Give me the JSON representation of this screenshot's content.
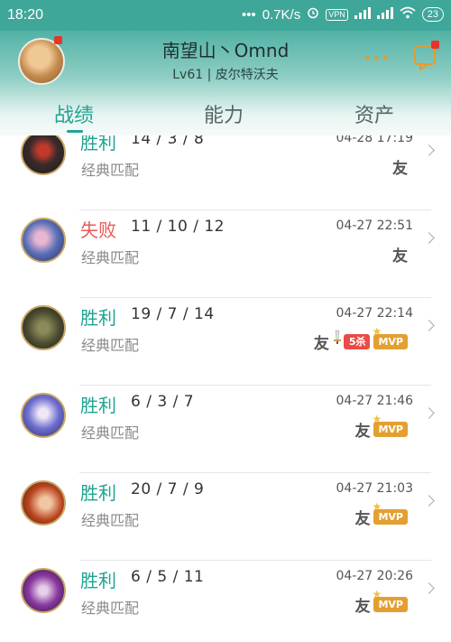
{
  "status_bar": {
    "time": "18:20",
    "more": "•••",
    "net_speed": "0.7K/s",
    "vpn": "VPN",
    "battery": "23"
  },
  "profile": {
    "name": "南望山丶Omnd",
    "sublevel": "Lv61 | 皮尔特沃夫",
    "more_dots": "•••",
    "accent_color": "#e69a2f"
  },
  "tabs": [
    {
      "label": "战绩",
      "active": true
    },
    {
      "label": "能力",
      "active": false
    },
    {
      "label": "资产",
      "active": false
    }
  ],
  "colors": {
    "win": "#1ea392",
    "lose": "#e85a52",
    "header": "#3fa79a",
    "kill_badge": "#e84c46",
    "mvp_badge": "#e3a031"
  },
  "matches": [
    {
      "result": "胜利",
      "outcome": "win",
      "kda": "14 / 3 / 8",
      "mode": "经典匹配",
      "datetime": "04-28 17:19",
      "friend": "友",
      "kill_streak": "",
      "mvp": "",
      "hero_icon": "zed-portrait"
    },
    {
      "result": "失败",
      "outcome": "lose",
      "kda": "11 / 10 / 12",
      "mode": "经典匹配",
      "datetime": "04-27 22:51",
      "friend": "友",
      "kill_streak": "",
      "mvp": "",
      "hero_icon": "jinx-portrait"
    },
    {
      "result": "胜利",
      "outcome": "win",
      "kda": "19 / 7 / 14",
      "mode": "经典匹配",
      "datetime": "04-27 22:14",
      "friend": "友",
      "kill_streak": "5杀",
      "mvp": "MVP",
      "hero_icon": "twitch-portrait"
    },
    {
      "result": "胜利",
      "outcome": "win",
      "kda": "6 / 3 / 7",
      "mode": "经典匹配",
      "datetime": "04-27 21:46",
      "friend": "友",
      "kill_streak": "",
      "mvp": "MVP",
      "hero_icon": "ashe-portrait"
    },
    {
      "result": "胜利",
      "outcome": "win",
      "kda": "20 / 7 / 9",
      "mode": "经典匹配",
      "datetime": "04-27 21:03",
      "friend": "友",
      "kill_streak": "",
      "mvp": "MVP",
      "hero_icon": "miss-fortune-portrait"
    },
    {
      "result": "胜利",
      "outcome": "win",
      "kda": "6 / 5 / 11",
      "mode": "经典匹配",
      "datetime": "04-27 20:26",
      "friend": "友",
      "kill_streak": "",
      "mvp": "MVP",
      "hero_icon": "vayne-portrait"
    }
  ]
}
